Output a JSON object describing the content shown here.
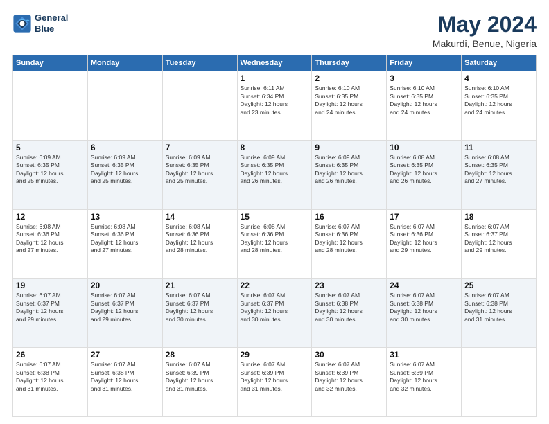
{
  "header": {
    "logo_line1": "General",
    "logo_line2": "Blue",
    "title": "May 2024",
    "subtitle": "Makurdi, Benue, Nigeria"
  },
  "weekdays": [
    "Sunday",
    "Monday",
    "Tuesday",
    "Wednesday",
    "Thursday",
    "Friday",
    "Saturday"
  ],
  "weeks": [
    [
      {
        "day": "",
        "info": ""
      },
      {
        "day": "",
        "info": ""
      },
      {
        "day": "",
        "info": ""
      },
      {
        "day": "1",
        "info": "Sunrise: 6:11 AM\nSunset: 6:34 PM\nDaylight: 12 hours\nand 23 minutes."
      },
      {
        "day": "2",
        "info": "Sunrise: 6:10 AM\nSunset: 6:35 PM\nDaylight: 12 hours\nand 24 minutes."
      },
      {
        "day": "3",
        "info": "Sunrise: 6:10 AM\nSunset: 6:35 PM\nDaylight: 12 hours\nand 24 minutes."
      },
      {
        "day": "4",
        "info": "Sunrise: 6:10 AM\nSunset: 6:35 PM\nDaylight: 12 hours\nand 24 minutes."
      }
    ],
    [
      {
        "day": "5",
        "info": "Sunrise: 6:09 AM\nSunset: 6:35 PM\nDaylight: 12 hours\nand 25 minutes."
      },
      {
        "day": "6",
        "info": "Sunrise: 6:09 AM\nSunset: 6:35 PM\nDaylight: 12 hours\nand 25 minutes."
      },
      {
        "day": "7",
        "info": "Sunrise: 6:09 AM\nSunset: 6:35 PM\nDaylight: 12 hours\nand 25 minutes."
      },
      {
        "day": "8",
        "info": "Sunrise: 6:09 AM\nSunset: 6:35 PM\nDaylight: 12 hours\nand 26 minutes."
      },
      {
        "day": "9",
        "info": "Sunrise: 6:09 AM\nSunset: 6:35 PM\nDaylight: 12 hours\nand 26 minutes."
      },
      {
        "day": "10",
        "info": "Sunrise: 6:08 AM\nSunset: 6:35 PM\nDaylight: 12 hours\nand 26 minutes."
      },
      {
        "day": "11",
        "info": "Sunrise: 6:08 AM\nSunset: 6:35 PM\nDaylight: 12 hours\nand 27 minutes."
      }
    ],
    [
      {
        "day": "12",
        "info": "Sunrise: 6:08 AM\nSunset: 6:36 PM\nDaylight: 12 hours\nand 27 minutes."
      },
      {
        "day": "13",
        "info": "Sunrise: 6:08 AM\nSunset: 6:36 PM\nDaylight: 12 hours\nand 27 minutes."
      },
      {
        "day": "14",
        "info": "Sunrise: 6:08 AM\nSunset: 6:36 PM\nDaylight: 12 hours\nand 28 minutes."
      },
      {
        "day": "15",
        "info": "Sunrise: 6:08 AM\nSunset: 6:36 PM\nDaylight: 12 hours\nand 28 minutes."
      },
      {
        "day": "16",
        "info": "Sunrise: 6:07 AM\nSunset: 6:36 PM\nDaylight: 12 hours\nand 28 minutes."
      },
      {
        "day": "17",
        "info": "Sunrise: 6:07 AM\nSunset: 6:36 PM\nDaylight: 12 hours\nand 29 minutes."
      },
      {
        "day": "18",
        "info": "Sunrise: 6:07 AM\nSunset: 6:37 PM\nDaylight: 12 hours\nand 29 minutes."
      }
    ],
    [
      {
        "day": "19",
        "info": "Sunrise: 6:07 AM\nSunset: 6:37 PM\nDaylight: 12 hours\nand 29 minutes."
      },
      {
        "day": "20",
        "info": "Sunrise: 6:07 AM\nSunset: 6:37 PM\nDaylight: 12 hours\nand 29 minutes."
      },
      {
        "day": "21",
        "info": "Sunrise: 6:07 AM\nSunset: 6:37 PM\nDaylight: 12 hours\nand 30 minutes."
      },
      {
        "day": "22",
        "info": "Sunrise: 6:07 AM\nSunset: 6:37 PM\nDaylight: 12 hours\nand 30 minutes."
      },
      {
        "day": "23",
        "info": "Sunrise: 6:07 AM\nSunset: 6:38 PM\nDaylight: 12 hours\nand 30 minutes."
      },
      {
        "day": "24",
        "info": "Sunrise: 6:07 AM\nSunset: 6:38 PM\nDaylight: 12 hours\nand 30 minutes."
      },
      {
        "day": "25",
        "info": "Sunrise: 6:07 AM\nSunset: 6:38 PM\nDaylight: 12 hours\nand 31 minutes."
      }
    ],
    [
      {
        "day": "26",
        "info": "Sunrise: 6:07 AM\nSunset: 6:38 PM\nDaylight: 12 hours\nand 31 minutes."
      },
      {
        "day": "27",
        "info": "Sunrise: 6:07 AM\nSunset: 6:38 PM\nDaylight: 12 hours\nand 31 minutes."
      },
      {
        "day": "28",
        "info": "Sunrise: 6:07 AM\nSunset: 6:39 PM\nDaylight: 12 hours\nand 31 minutes."
      },
      {
        "day": "29",
        "info": "Sunrise: 6:07 AM\nSunset: 6:39 PM\nDaylight: 12 hours\nand 31 minutes."
      },
      {
        "day": "30",
        "info": "Sunrise: 6:07 AM\nSunset: 6:39 PM\nDaylight: 12 hours\nand 32 minutes."
      },
      {
        "day": "31",
        "info": "Sunrise: 6:07 AM\nSunset: 6:39 PM\nDaylight: 12 hours\nand 32 minutes."
      },
      {
        "day": "",
        "info": ""
      }
    ]
  ]
}
